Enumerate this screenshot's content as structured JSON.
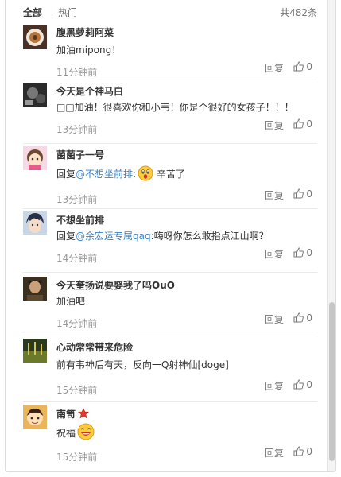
{
  "header": {
    "tab_all": "全部",
    "tab_hot": "热门",
    "total": "共482条"
  },
  "ui": {
    "reply_label": "回复",
    "accent_color": "#3a82c4"
  },
  "comments": [
    {
      "user": "腹黑萝莉阿菜",
      "text": "加油mipong！",
      "time": "11分钟前",
      "likes": "0",
      "avatar_icon": "round-badge-avatar"
    },
    {
      "user": "今天是个神马白",
      "text": "□□加油！很喜欢你和小韦！你是个很好的女孩子！！！",
      "time": "13分钟前",
      "likes": "0",
      "avatar_icon": "dark-photo-avatar"
    },
    {
      "user": "菌菌子一号",
      "reply_prefix": "回复",
      "mention": "@不想坐前排",
      "after_mention": ":",
      "text": " 辛苦了",
      "time": "13分钟前",
      "likes": "0",
      "avatar_icon": "cartoon-girl-avatar",
      "emoji_icon": "surprised-face-emoji"
    },
    {
      "user": "不想坐前排",
      "reply_prefix": "回复",
      "mention": "@余宏运专属qaq",
      "after_mention": ":嗨呀你怎么敢指点江山啊？",
      "time": "14分钟前",
      "likes": "0",
      "avatar_icon": "anime-boy-avatar"
    },
    {
      "user": "今天奎扬说要娶我了吗OuO",
      "text": "加油吧",
      "time": "14分钟前",
      "likes": "0",
      "avatar_icon": "portrait-photo-avatar"
    },
    {
      "user": "心动常常带来危险",
      "text": "前有韦神后有天，反向一Q射神仙[doge]",
      "time": "15分钟前",
      "likes": "0",
      "avatar_icon": "field-photo-avatar"
    },
    {
      "user": "南笥",
      "text": "祝福",
      "time": "15分钟前",
      "likes": "0",
      "avatar_icon": "cartoon-kid-avatar",
      "badge_icon": "red-star-icon",
      "emoji_icon": "laughing-face-emoji"
    }
  ]
}
